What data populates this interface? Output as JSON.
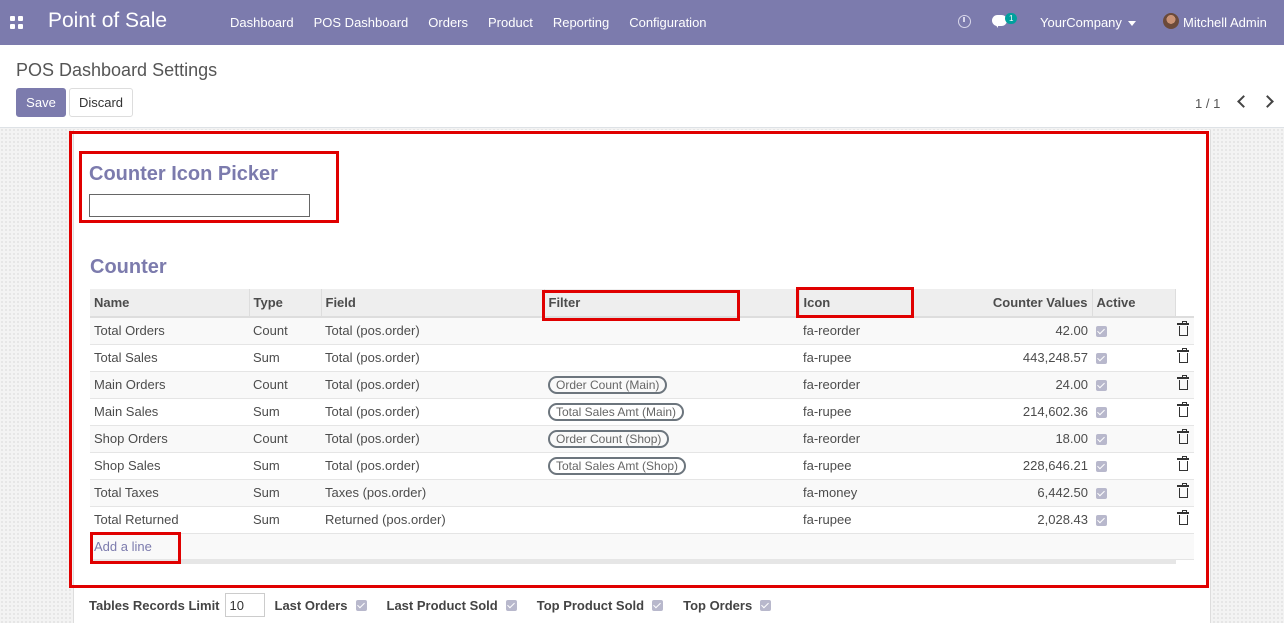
{
  "navbar": {
    "brand": "Point of Sale",
    "menu": [
      "Dashboard",
      "POS Dashboard",
      "Orders",
      "Product",
      "Reporting",
      "Configuration"
    ],
    "messages_badge": "1",
    "company": "YourCompany",
    "user": "Mitchell Admin",
    "color": "#7c7bad"
  },
  "control_panel": {
    "breadcrumb": "POS Dashboard Settings",
    "save_label": "Save",
    "discard_label": "Discard",
    "pager": "1 / 1"
  },
  "form": {
    "icon_picker_title": "Counter Icon Picker",
    "icon_picker_value": "",
    "counter_title": "Counter",
    "columns": [
      "Name",
      "Type",
      "Field",
      "Filter",
      "Icon",
      "Counter Values",
      "Active"
    ],
    "rows": [
      {
        "name": "Total Orders",
        "type": "Count",
        "field": "Total (pos.order)",
        "filter": "",
        "icon": "fa-reorder",
        "value": "42.00",
        "active": true
      },
      {
        "name": "Total Sales",
        "type": "Sum",
        "field": "Total (pos.order)",
        "filter": "",
        "icon": "fa-rupee",
        "value": "443,248.57",
        "active": true
      },
      {
        "name": "Main Orders",
        "type": "Count",
        "field": "Total (pos.order)",
        "filter": "Order Count (Main)",
        "icon": "fa-reorder",
        "value": "24.00",
        "active": true
      },
      {
        "name": "Main Sales",
        "type": "Sum",
        "field": "Total (pos.order)",
        "filter": "Total Sales Amt (Main)",
        "icon": "fa-rupee",
        "value": "214,602.36",
        "active": true
      },
      {
        "name": "Shop Orders",
        "type": "Count",
        "field": "Total (pos.order)",
        "filter": "Order Count (Shop)",
        "icon": "fa-reorder",
        "value": "18.00",
        "active": true
      },
      {
        "name": "Shop Sales",
        "type": "Sum",
        "field": "Total (pos.order)",
        "filter": "Total Sales Amt (Shop)",
        "icon": "fa-rupee",
        "value": "228,646.21",
        "active": true
      },
      {
        "name": "Total Taxes",
        "type": "Sum",
        "field": "Taxes (pos.order)",
        "filter": "",
        "icon": "fa-money",
        "value": "6,442.50",
        "active": true
      },
      {
        "name": "Total Returned",
        "type": "Sum",
        "field": "Returned (pos.order)",
        "filter": "",
        "icon": "fa-rupee",
        "value": "2,028.43",
        "active": true
      }
    ],
    "add_line_label": "Add a line",
    "tables_records_limit_label": "Tables Records Limit",
    "tables_records_limit_value": "10",
    "toggles": [
      {
        "label": "Last Orders",
        "checked": true
      },
      {
        "label": "Last Product Sold",
        "checked": true
      },
      {
        "label": "Top Product Sold",
        "checked": true
      },
      {
        "label": "Top Orders",
        "checked": true
      }
    ]
  },
  "annotation_color": "#e00000"
}
